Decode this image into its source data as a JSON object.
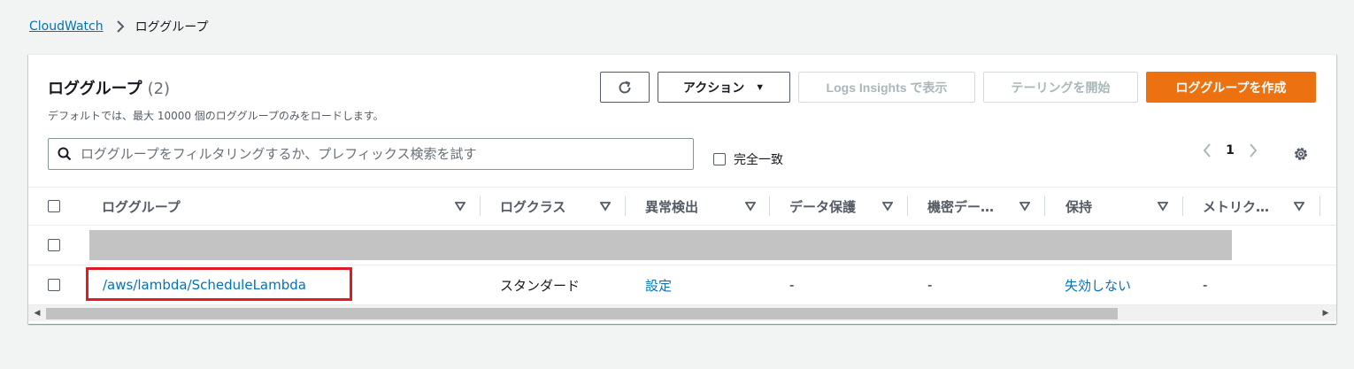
{
  "breadcrumb": {
    "root": "CloudWatch",
    "current": "ロググループ"
  },
  "panel": {
    "title": "ロググループ",
    "count": "(2)",
    "description": "デフォルトでは、最大 10000 個のロググループのみをロードします。"
  },
  "toolbar": {
    "actions_label": "アクション",
    "insights_label": "Logs Insights で表示",
    "tail_label": "テーリングを開始",
    "create_label": "ロググループを作成"
  },
  "search": {
    "placeholder": "ロググループをフィルタリングするか、プレフィックス検索を試す"
  },
  "exact_match_label": "完全一致",
  "pagination": {
    "current_page": "1"
  },
  "table": {
    "columns": [
      "ロググループ",
      "ログクラス",
      "異常検出",
      "データ保護",
      "機密デー…",
      "保持",
      "メトリク…"
    ],
    "rows": [
      {
        "log_group": "/aws/lambda/ScheduleLambda",
        "log_class": "スタンダード",
        "anomaly": "設定",
        "data_protection": "-",
        "sensitive": "-",
        "retention": "失効しない",
        "metric": "-"
      }
    ]
  },
  "colors": {
    "link": "#0073bb",
    "primary": "#ec7211",
    "highlight": "#e01b24"
  }
}
